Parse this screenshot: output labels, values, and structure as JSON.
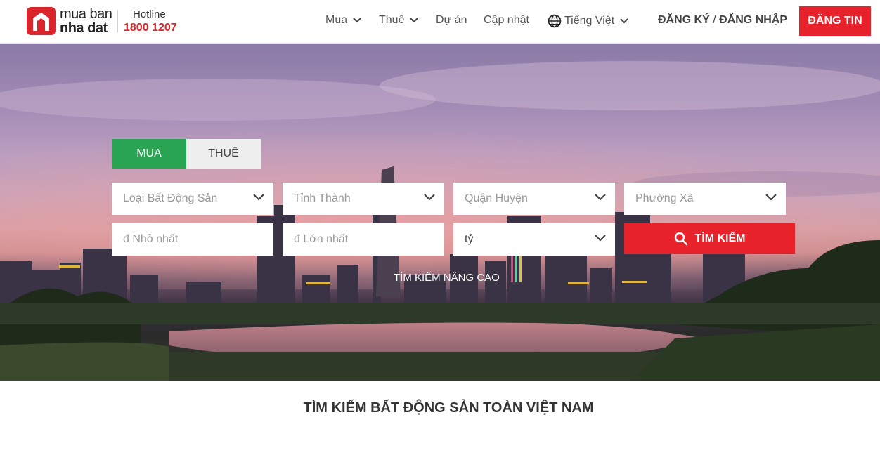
{
  "brand": {
    "logo_line1": "mua ban",
    "logo_line2": "nha dat",
    "hotline_label": "Hotline",
    "hotline_number": "1800 1207",
    "accent": "#d9252b"
  },
  "nav": {
    "items": [
      {
        "label": "Mua",
        "dropdown": true
      },
      {
        "label": "Thuê",
        "dropdown": true
      },
      {
        "label": "Dự án",
        "dropdown": false
      },
      {
        "label": "Cập nhật",
        "dropdown": false
      },
      {
        "label": "Tiếng Việt",
        "dropdown": true,
        "icon": "globe-icon"
      }
    ],
    "register": "ĐĂNG KÝ",
    "separator": "/",
    "login": "ĐĂNG NHẬP",
    "post": "ĐĂNG TIN"
  },
  "search": {
    "tabs": [
      {
        "label": "MUA",
        "active": true
      },
      {
        "label": "THUÊ",
        "active": false
      }
    ],
    "property_type": {
      "placeholder": "Loại Bất Động Sản"
    },
    "province": {
      "placeholder": "Tỉnh Thành"
    },
    "district": {
      "placeholder": "Quận Huyện"
    },
    "ward": {
      "placeholder": "Phường Xã"
    },
    "min_price": {
      "placeholder": "đ Nhỏ nhất"
    },
    "max_price": {
      "placeholder": "đ Lớn nhất"
    },
    "unit": {
      "value": "tỷ"
    },
    "button": "TÌM KIẾM",
    "advanced": "TÌM KIẾM NÂNG CAO",
    "colors": {
      "tab_active": "#2aa553",
      "button": "#e8222a"
    }
  },
  "section": {
    "title": "TÌM KIẾM BẤT ĐỘNG SẢN TOÀN VIỆT NAM"
  }
}
